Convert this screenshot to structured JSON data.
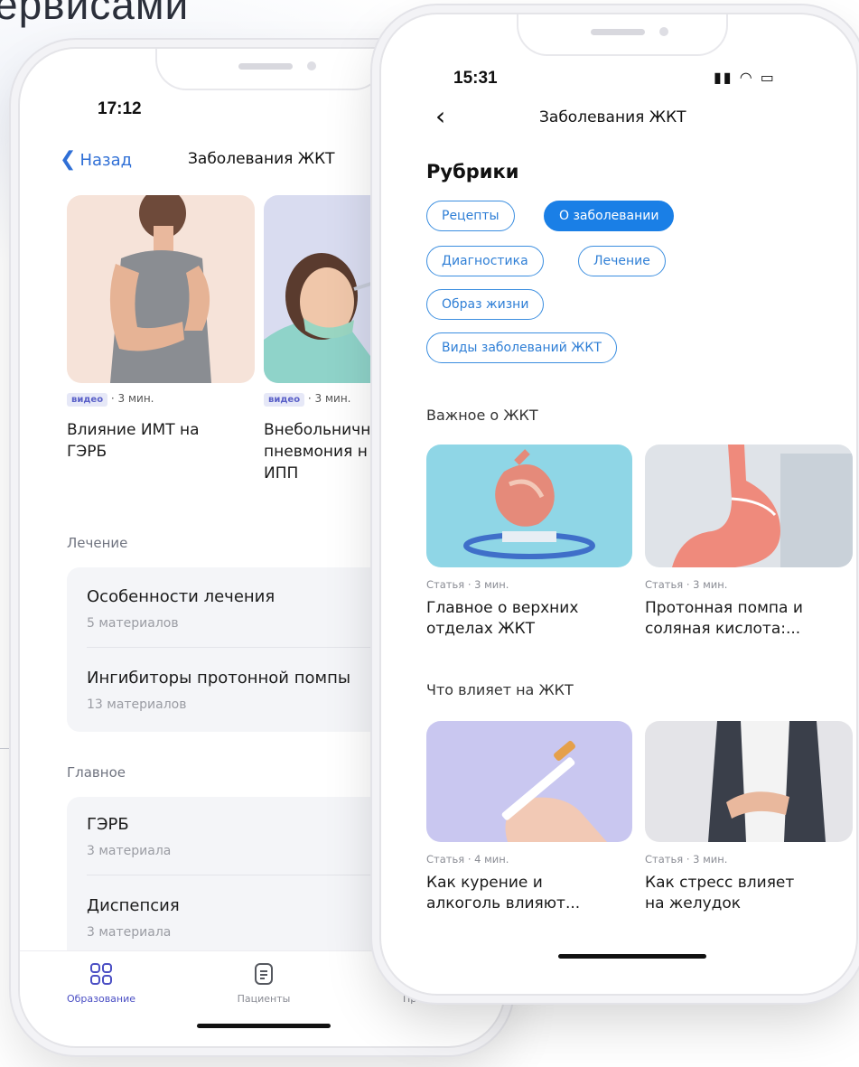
{
  "hero": {
    "title_fragment": "ервисами"
  },
  "back_phone": {
    "status": {
      "time": "17:12"
    },
    "nav": {
      "back_label": "Назад",
      "title": "Заболевания ЖКТ"
    },
    "videos": [
      {
        "tag": "видео",
        "duration": "· 3 мин.",
        "title_line1": "Влияние ИМТ на",
        "title_line2": "ГЭРБ"
      },
      {
        "tag": "видео",
        "duration": "· 3 мин.",
        "title_line1": "Внебольничн",
        "title_line2": "пневмония н",
        "title_line3": "ИПП"
      }
    ],
    "sections": [
      {
        "label": "Лечение",
        "items": [
          {
            "title": "Особенности лечения",
            "count": "5 материалов"
          },
          {
            "title": "Ингибиторы протонной помпы",
            "count": "13 материалов"
          }
        ]
      },
      {
        "label": "Главное",
        "items": [
          {
            "title": "ГЭРБ",
            "count": "3 материала"
          },
          {
            "title": "Диспепсия",
            "count": "3 материала"
          }
        ]
      }
    ],
    "tabs": [
      {
        "label": "Образование",
        "icon": "grid-icon"
      },
      {
        "label": "Пациенты",
        "icon": "document-icon"
      },
      {
        "label": "Профиль",
        "icon": "profile-icon"
      }
    ]
  },
  "front_phone": {
    "status": {
      "time": "15:31"
    },
    "nav": {
      "title": "Заболевания ЖКТ"
    },
    "rubrics_title": "Рубрики",
    "chips": [
      {
        "label": "Рецепты",
        "active": false
      },
      {
        "label": "О заболевании",
        "active": true
      },
      {
        "label": "Диагностика",
        "active": false
      },
      {
        "label": "Лечение",
        "active": false
      },
      {
        "label": "Образ жизни",
        "active": false
      },
      {
        "label": "Виды заболеваний ЖКТ",
        "active": false
      }
    ],
    "sections": [
      {
        "label": "Важное о ЖКТ",
        "cards": [
          {
            "meta": "Статья · 3 мин.",
            "title_line1": "Главное о верхних",
            "title_line2": "отделах ЖКТ"
          },
          {
            "meta": "Статья · 3 мин.",
            "title_line1": "Протонная помпа и",
            "title_line2": "соляная кислота:..."
          }
        ]
      },
      {
        "label": "Что влияет на ЖКТ",
        "cards": [
          {
            "meta": "Статья · 4 мин.",
            "title_line1": "Как курение и",
            "title_line2": "алкоголь влияют..."
          },
          {
            "meta": "Статья · 3 мин.",
            "title_line1": "Как стресс влияет",
            "title_line2": "на желудок"
          }
        ]
      }
    ]
  },
  "colors": {
    "accent": "#1a7fe6",
    "chip_border": "#3b8ee0",
    "link": "#2f6fd6",
    "tag_bg": "#e6e8f7",
    "tag_text": "#5a60c8",
    "tab_active": "#4b4fc4"
  }
}
